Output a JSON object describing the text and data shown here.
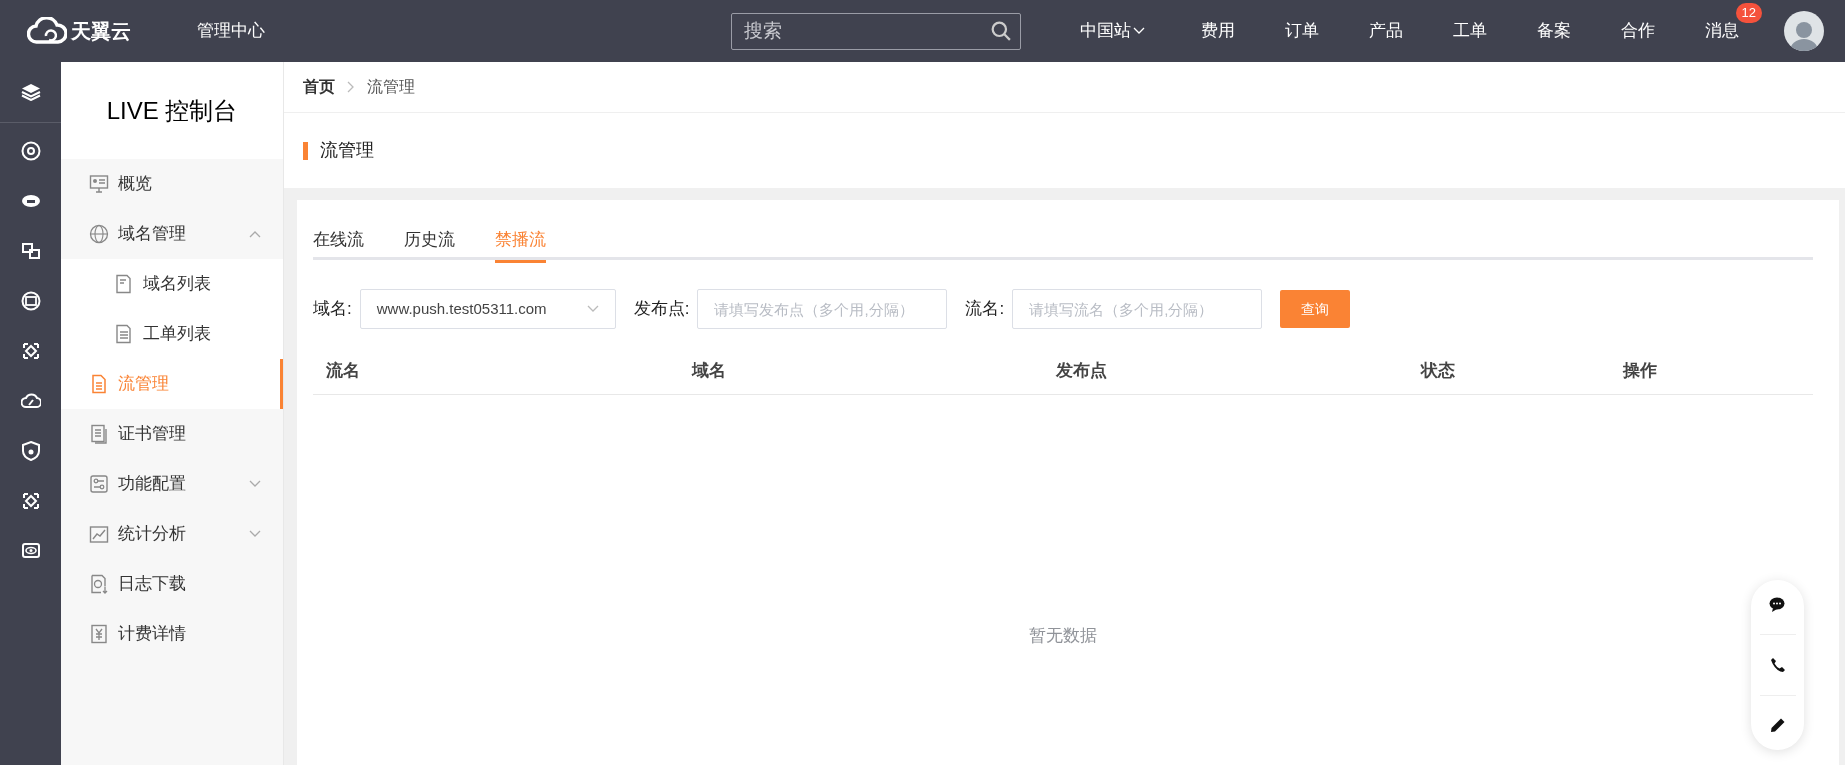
{
  "top_bar": {
    "brand": "天翼云",
    "title": "管理中心",
    "search": {
      "placeholder": "搜索"
    },
    "nav": [
      {
        "label": "中国站",
        "kind": "dropdown"
      },
      {
        "label": "费用",
        "kind": "link"
      },
      {
        "label": "订单",
        "kind": "link"
      },
      {
        "label": "产品",
        "kind": "link"
      },
      {
        "label": "工单",
        "kind": "link"
      },
      {
        "label": "备案",
        "kind": "link"
      },
      {
        "label": "合作",
        "kind": "link"
      },
      {
        "label": "消息",
        "kind": "link",
        "badge": "12"
      }
    ]
  },
  "sidebar": {
    "title": "LIVE 控制台",
    "items": [
      {
        "label": "概览",
        "selected": false
      },
      {
        "label": "域名管理",
        "selected": false,
        "expanded": true,
        "children": [
          {
            "label": "域名列表",
            "selected": false
          },
          {
            "label": "工单列表",
            "selected": false
          }
        ]
      },
      {
        "label": "流管理",
        "selected": true
      },
      {
        "label": "证书管理",
        "selected": false
      },
      {
        "label": "功能配置",
        "selected": false,
        "expanded": false
      },
      {
        "label": "统计分析",
        "selected": false,
        "expanded": false
      },
      {
        "label": "日志下载",
        "selected": false
      },
      {
        "label": "计费详情",
        "selected": false
      }
    ]
  },
  "breadcrumb": [
    "首页",
    "流管理"
  ],
  "page_title": "流管理",
  "tabs": [
    {
      "label": "在线流",
      "selected": false
    },
    {
      "label": "历史流",
      "selected": false
    },
    {
      "label": "禁播流",
      "selected": true
    }
  ],
  "filters": [
    {
      "label": "域名:",
      "kind": "select",
      "value": "www.push.test05311.com"
    },
    {
      "label": "发布点:",
      "kind": "input",
      "placeholder": "请填写发布点（多个用,分隔）"
    },
    {
      "label": "流名:",
      "kind": "input",
      "placeholder": "请填写流名（多个用,分隔）"
    }
  ],
  "query_button": "查询",
  "table": {
    "columns": [
      "流名",
      "域名",
      "发布点",
      "状态",
      "操作"
    ],
    "empty_text": "暂无数据"
  }
}
